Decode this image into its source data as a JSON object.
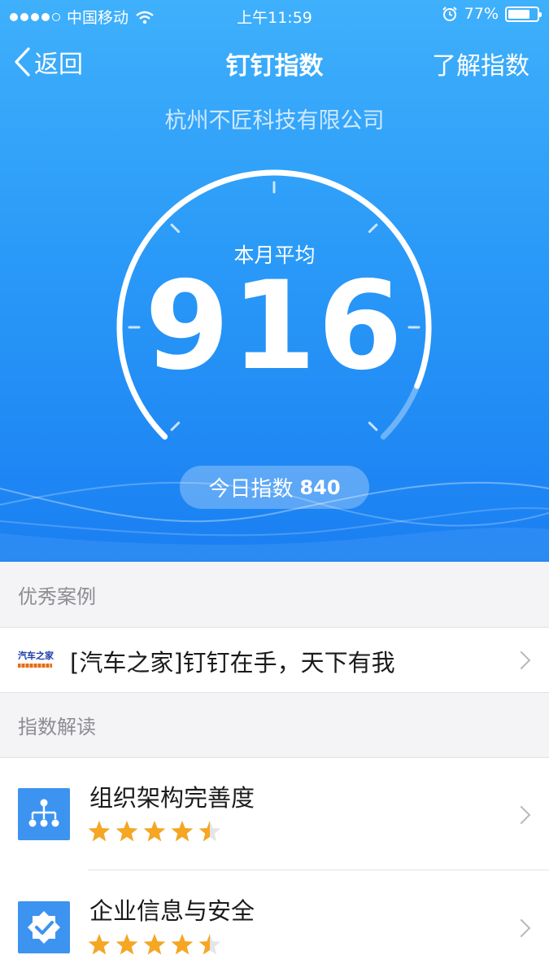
{
  "status_bar": {
    "carrier": "中国移动",
    "time": "上午11:59",
    "battery_percent": "77%",
    "battery_level": 0.77
  },
  "nav": {
    "back_label": "返回",
    "title": "钉钉指数",
    "right_label": "了解指数"
  },
  "company": "杭州不匠科技有限公司",
  "gauge": {
    "label": "本月平均",
    "value": "916",
    "fill_fraction": 0.916
  },
  "today": {
    "label": "今日指数",
    "value": "840"
  },
  "sections": {
    "cases_title": "优秀案例",
    "interpretation_title": "指数解读"
  },
  "case": {
    "logo_text": "汽车之家",
    "title": "[汽车之家]钉钉在手，天下有我"
  },
  "interpretation": [
    {
      "title": "组织架构完善度",
      "icon": "org-chart-icon",
      "rating": 4.5
    },
    {
      "title": "企业信息与安全",
      "icon": "shield-check-icon",
      "rating": 4.5
    }
  ],
  "colors": {
    "primary_blue": "#2a9af8",
    "star": "#f5a623",
    "icon_bg": "#3d93f0"
  }
}
